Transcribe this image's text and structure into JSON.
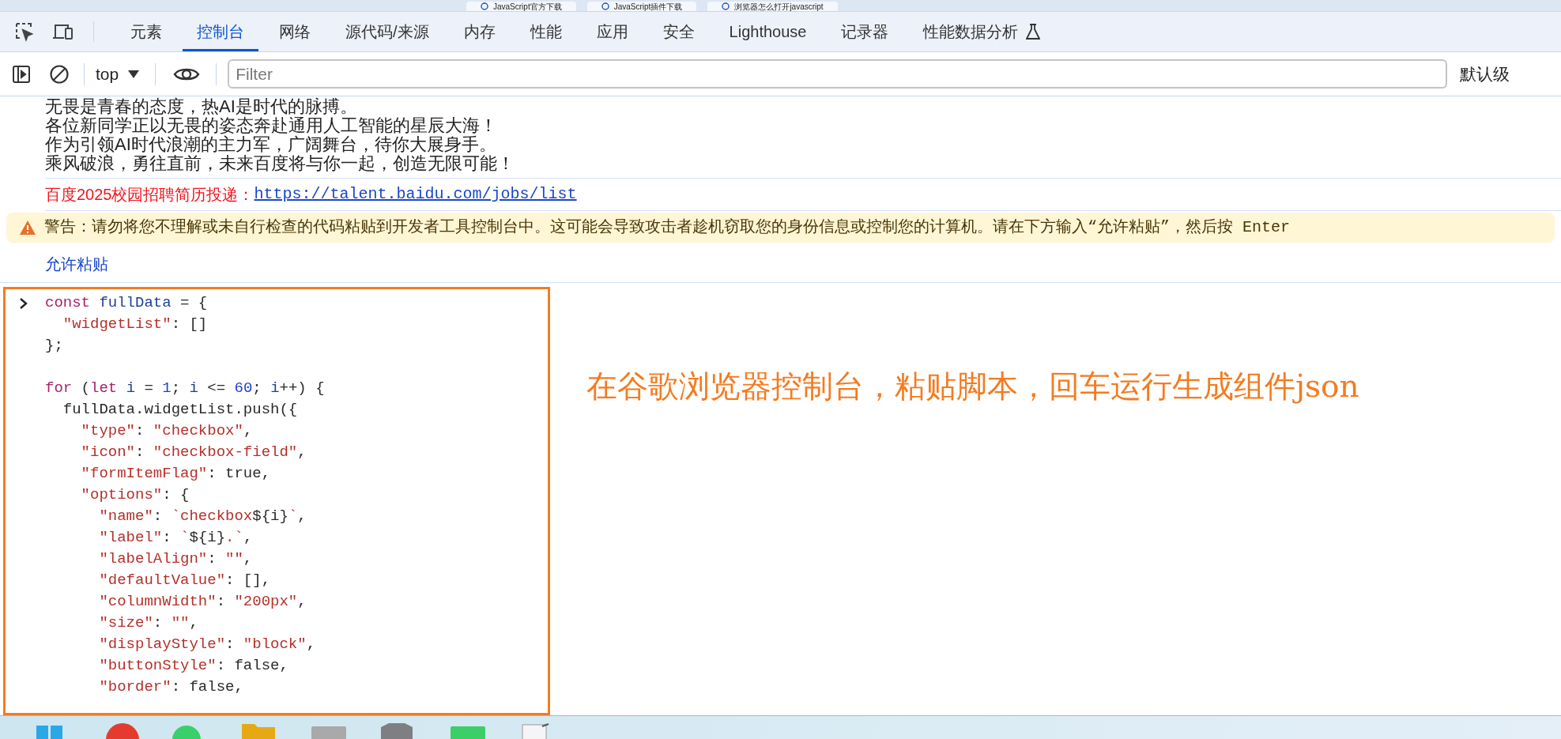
{
  "browser_tabs": [
    {
      "title": "JavaScript官方下载"
    },
    {
      "title": "JavaScript插件下载"
    },
    {
      "title": "浏览器怎么打开javascript"
    }
  ],
  "devtools_tabs": [
    {
      "label": "元素",
      "selected": false
    },
    {
      "label": "控制台",
      "selected": true
    },
    {
      "label": "网络",
      "selected": false
    },
    {
      "label": "源代码/来源",
      "selected": false
    },
    {
      "label": "内存",
      "selected": false
    },
    {
      "label": "性能",
      "selected": false
    },
    {
      "label": "应用",
      "selected": false
    },
    {
      "label": "安全",
      "selected": false
    },
    {
      "label": "Lighthouse",
      "selected": false
    },
    {
      "label": "记录器",
      "selected": false
    },
    {
      "label": "性能数据分析",
      "selected": false,
      "experimental": true
    }
  ],
  "toolbar": {
    "context": "top",
    "filter_placeholder": "Filter",
    "level_label": "默认级"
  },
  "console_messages": [
    {
      "kind": "log",
      "lines": [
        "无畏是青春的态度，热AI是时代的脉搏。",
        "各位新同学正以无畏的姿态奔赴通用人工智能的星辰大海！",
        "作为引领AI时代浪潮的主力军，广阔舞台，待你大展身手。",
        "乘风破浪，勇往直前，未来百度将与你一起，创造无限可能！"
      ]
    },
    {
      "kind": "link_log",
      "text": "百度2025校园招聘简历投递：",
      "link": "https://talent.baidu.com/jobs/list"
    },
    {
      "kind": "warning",
      "text": "警告：请勿将您不理解或未自行检查的代码粘贴到开发者工具控制台中。这可能会导致攻击者趁机窃取您的身份信息或控制您的计算机。请在下方输入“允许粘贴”，然后按 Enter"
    },
    {
      "kind": "echo",
      "text": "允许粘贴"
    }
  ],
  "code_lines": [
    [
      {
        "kind": "keyword",
        "text": "const"
      },
      {
        "kind": "variable",
        "text": " fullData"
      },
      {
        "kind": "plain",
        "text": " = {"
      }
    ],
    [
      {
        "kind": "string",
        "text": "  \"widgetList\""
      },
      {
        "kind": "plain",
        "text": ": []"
      }
    ],
    [
      {
        "kind": "plain",
        "text": "};"
      }
    ],
    [
      {
        "kind": "blank"
      }
    ],
    [
      {
        "kind": "keyword",
        "text": "for"
      },
      {
        "kind": "plain",
        "text": " ("
      },
      {
        "kind": "keyword",
        "text": "let"
      },
      {
        "kind": "variable",
        "text": " i"
      },
      {
        "kind": "plain",
        "text": " = "
      },
      {
        "kind": "number",
        "text": "1"
      },
      {
        "kind": "plain",
        "text": "; "
      },
      {
        "kind": "variable",
        "text": "i"
      },
      {
        "kind": "plain",
        "text": " <= "
      },
      {
        "kind": "number",
        "text": "60"
      },
      {
        "kind": "plain",
        "text": "; "
      },
      {
        "kind": "variable",
        "text": "i"
      },
      {
        "kind": "plain",
        "text": "++) {"
      }
    ],
    [
      {
        "kind": "plain",
        "text": "  fullData.widgetList.push({"
      }
    ],
    [
      {
        "kind": "string",
        "text": "    \"type\""
      },
      {
        "kind": "plain",
        "text": ": "
      },
      {
        "kind": "string",
        "text": "\"checkbox\""
      },
      {
        "kind": "plain",
        "text": ","
      }
    ],
    [
      {
        "kind": "string",
        "text": "    \"icon\""
      },
      {
        "kind": "plain",
        "text": ": "
      },
      {
        "kind": "string",
        "text": "\"checkbox-field\""
      },
      {
        "kind": "plain",
        "text": ","
      }
    ],
    [
      {
        "kind": "string",
        "text": "    \"formItemFlag\""
      },
      {
        "kind": "plain",
        "text": ": true,"
      }
    ],
    [
      {
        "kind": "string",
        "text": "    \"options\""
      },
      {
        "kind": "plain",
        "text": ": {"
      }
    ],
    [
      {
        "kind": "string",
        "text": "      \"name\""
      },
      {
        "kind": "plain",
        "text": ": "
      },
      {
        "kind": "string",
        "text": "`checkbox"
      },
      {
        "kind": "plain",
        "text": "${i}"
      },
      {
        "kind": "string",
        "text": "`"
      },
      {
        "kind": "plain",
        "text": ","
      }
    ],
    [
      {
        "kind": "string",
        "text": "      \"label\""
      },
      {
        "kind": "plain",
        "text": ": "
      },
      {
        "kind": "string",
        "text": "`"
      },
      {
        "kind": "plain",
        "text": "${i}"
      },
      {
        "kind": "string",
        "text": ".`"
      },
      {
        "kind": "plain",
        "text": ","
      }
    ],
    [
      {
        "kind": "string",
        "text": "      \"labelAlign\""
      },
      {
        "kind": "plain",
        "text": ": "
      },
      {
        "kind": "string",
        "text": "\"\""
      },
      {
        "kind": "plain",
        "text": ","
      }
    ],
    [
      {
        "kind": "string",
        "text": "      \"defaultValue\""
      },
      {
        "kind": "plain",
        "text": ": [],"
      }
    ],
    [
      {
        "kind": "string",
        "text": "      \"columnWidth\""
      },
      {
        "kind": "plain",
        "text": ": "
      },
      {
        "kind": "string",
        "text": "\"200px\""
      },
      {
        "kind": "plain",
        "text": ","
      }
    ],
    [
      {
        "kind": "string",
        "text": "      \"size\""
      },
      {
        "kind": "plain",
        "text": ": "
      },
      {
        "kind": "string",
        "text": "\"\""
      },
      {
        "kind": "plain",
        "text": ","
      }
    ],
    [
      {
        "kind": "string",
        "text": "      \"displayStyle\""
      },
      {
        "kind": "plain",
        "text": ": "
      },
      {
        "kind": "string",
        "text": "\"block\""
      },
      {
        "kind": "plain",
        "text": ","
      }
    ],
    [
      {
        "kind": "string",
        "text": "      \"buttonStyle\""
      },
      {
        "kind": "plain",
        "text": ": false,"
      }
    ],
    [
      {
        "kind": "string",
        "text": "      \"border\""
      },
      {
        "kind": "plain",
        "text": ": false,"
      }
    ]
  ],
  "annotation": {
    "text": "在谷歌浏览器控制台，粘贴脚本，回车运行生成组件json"
  }
}
